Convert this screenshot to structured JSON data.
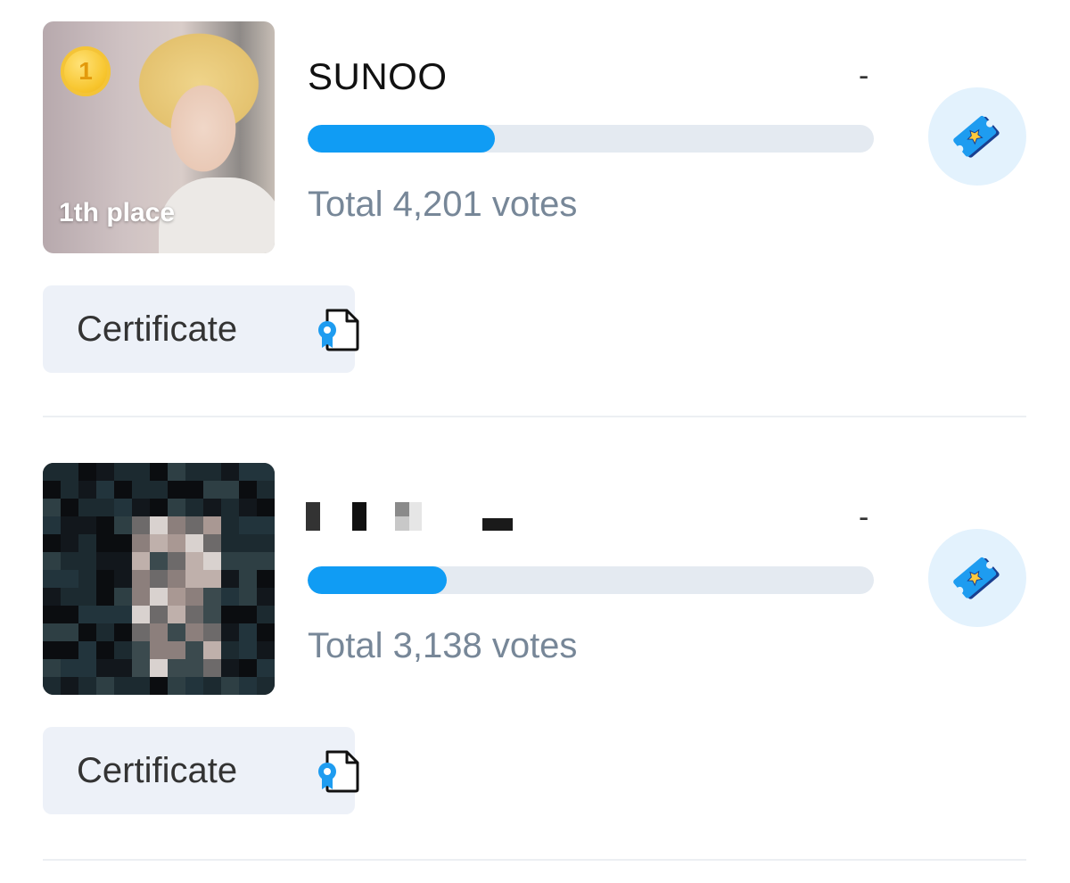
{
  "entries": [
    {
      "place_badge": "1",
      "place_label": "1th place",
      "name": "SUNOO",
      "rank_change": "-",
      "votes_text": "Total 4,201 votes",
      "progress_fraction": 0.33,
      "certificate_label": "Certificate",
      "vote_icon": "ticket-star-icon",
      "certificate_icon": "certificate-document-icon"
    },
    {
      "place_badge": "",
      "place_label": "",
      "name": "",
      "rank_change": "-",
      "votes_text": "Total 3,138 votes",
      "progress_fraction": 0.246,
      "certificate_label": "Certificate",
      "vote_icon": "ticket-star-icon",
      "certificate_icon": "certificate-document-icon"
    }
  ],
  "colors": {
    "progress_fill": "#109cf4",
    "progress_track": "#e4eaf1",
    "votes_text": "#778798",
    "certificate_bg": "#edf1f8",
    "vote_button_bg": "#e3f2fd"
  }
}
